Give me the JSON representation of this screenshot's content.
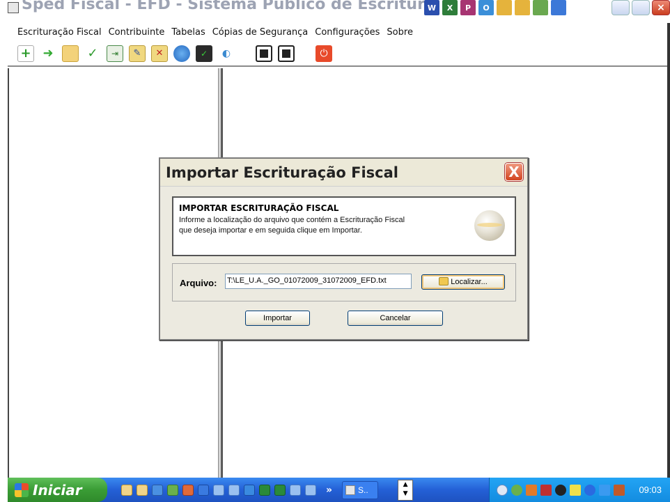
{
  "window": {
    "title": "Sped Fiscal - EFD - Sistema Público de Escrituração D"
  },
  "menu": {
    "items": [
      "Escrituração Fiscal",
      "Contribuinte",
      "Tabelas",
      "Cópias de Segurança",
      "Configurações",
      "Sobre"
    ]
  },
  "toolbar": {
    "icons": [
      "new-icon",
      "import-icon",
      "open-folder-icon",
      "validate-check-icon",
      "export-icon",
      "edit-icon",
      "delete-icon",
      "web-icon",
      "sign-icon",
      "transmit-icon",
      "backup-save-icon",
      "restore-save-icon",
      "exit-power-icon"
    ]
  },
  "dialog": {
    "title": "Importar Escrituração Fiscal",
    "close_label": "X",
    "header": "IMPORTAR ESCRITURAÇÃO FISCAL",
    "description_line1": "Informe a localização do arquivo que contém a Escrituração Fiscal",
    "description_line2": "que deseja importar e em seguida clique em Importar.",
    "file_label": "Arquivo:",
    "file_value": "T:\\LE_U.A._GO_01072009_31072009_EFD.txt",
    "locate_button": "Localizar...",
    "import_button": "Importar",
    "cancel_button": "Cancelar"
  },
  "taskbar": {
    "start_label": "Iniciar",
    "more_label": "»",
    "task_label": "S..",
    "clock": "09:03"
  }
}
